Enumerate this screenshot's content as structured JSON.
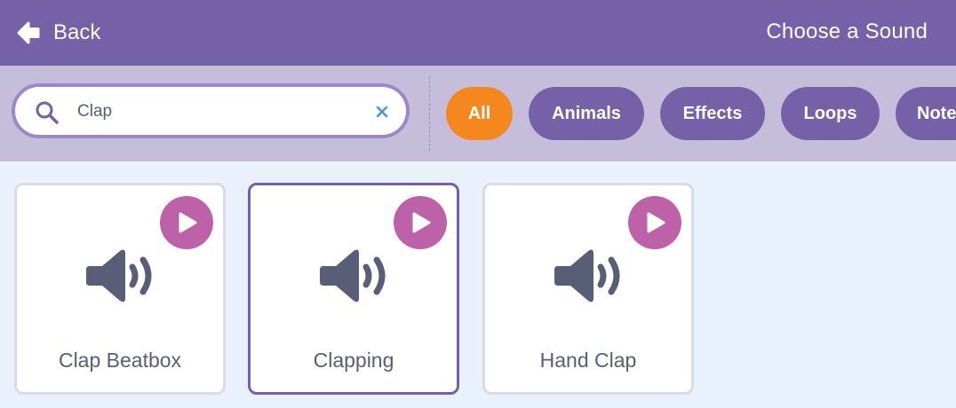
{
  "header": {
    "back_label": "Back",
    "title": "Choose a Sound"
  },
  "search": {
    "value": "Clap",
    "placeholder": "Search"
  },
  "tags": [
    {
      "label": "All",
      "active": true
    },
    {
      "label": "Animals",
      "active": false
    },
    {
      "label": "Effects",
      "active": false
    },
    {
      "label": "Loops",
      "active": false
    },
    {
      "label": "Notes",
      "active": false
    }
  ],
  "sounds": [
    {
      "name": "Clap Beatbox",
      "selected": false
    },
    {
      "name": "Clapping",
      "selected": true
    },
    {
      "name": "Hand Clap",
      "selected": false
    }
  ],
  "colors": {
    "header": "#7660a8",
    "filter_bar": "#c6bddb",
    "active_tag": "#f4881e",
    "play_button": "#bd62a8",
    "background": "#e9f1fc"
  },
  "icons": [
    "back-arrow-icon",
    "search-icon",
    "clear-icon",
    "play-icon",
    "speaker-icon"
  ]
}
